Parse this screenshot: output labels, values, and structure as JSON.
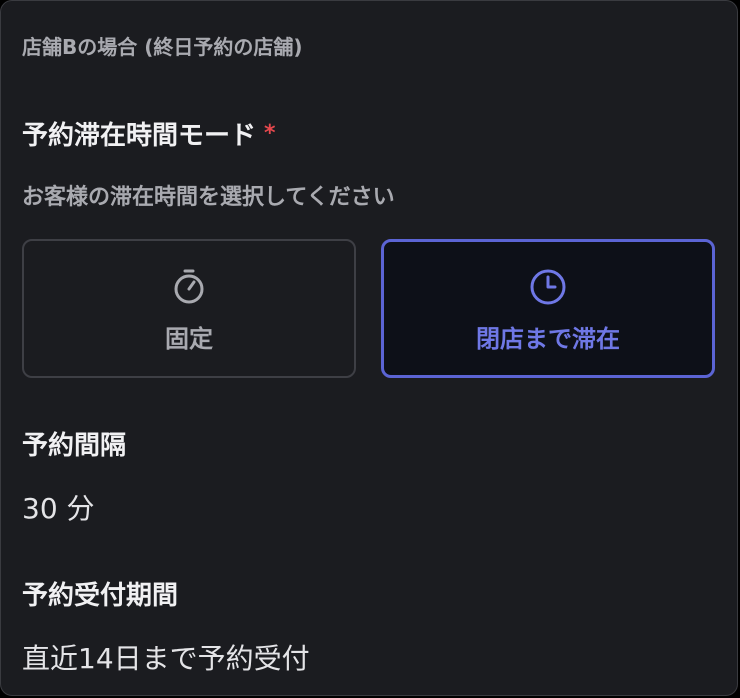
{
  "panel": {
    "title": "店舗Bの場合 (終日予約の店舗)"
  },
  "stay_mode": {
    "label": "予約滞在時間モード",
    "required_mark": "*",
    "help": "お客様の滞在時間を選択してください",
    "options": [
      {
        "label": "固定",
        "icon": "stopwatch-icon",
        "selected": false
      },
      {
        "label": "閉店まで滞在",
        "icon": "clock-icon",
        "selected": true
      }
    ]
  },
  "interval": {
    "label": "予約間隔",
    "value": "30 分"
  },
  "acceptance": {
    "label": "予約受付期間",
    "value": "直近14日まで予約受付"
  },
  "colors": {
    "panel_bg": "#1b1c20",
    "accent": "#5b64d4",
    "required": "#e5484d"
  }
}
